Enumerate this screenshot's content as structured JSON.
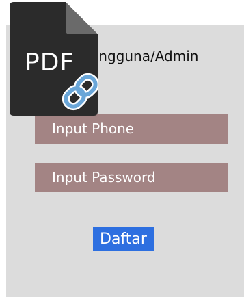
{
  "form": {
    "title": "engguna/Admin",
    "phone_placeholder": "Input Phone",
    "password_placeholder": "Input Password",
    "submit_label": "Daftar"
  },
  "overlay": {
    "badge_text": "PDF",
    "icons": [
      "pdf-file-icon",
      "link-icon"
    ]
  },
  "colors": {
    "panel_background": "#dcdcdc",
    "field_background": "#a38484",
    "submit_background": "#2d6fe0",
    "badge_background": "#2b2b2b",
    "link_color": "#6aa6d8"
  }
}
